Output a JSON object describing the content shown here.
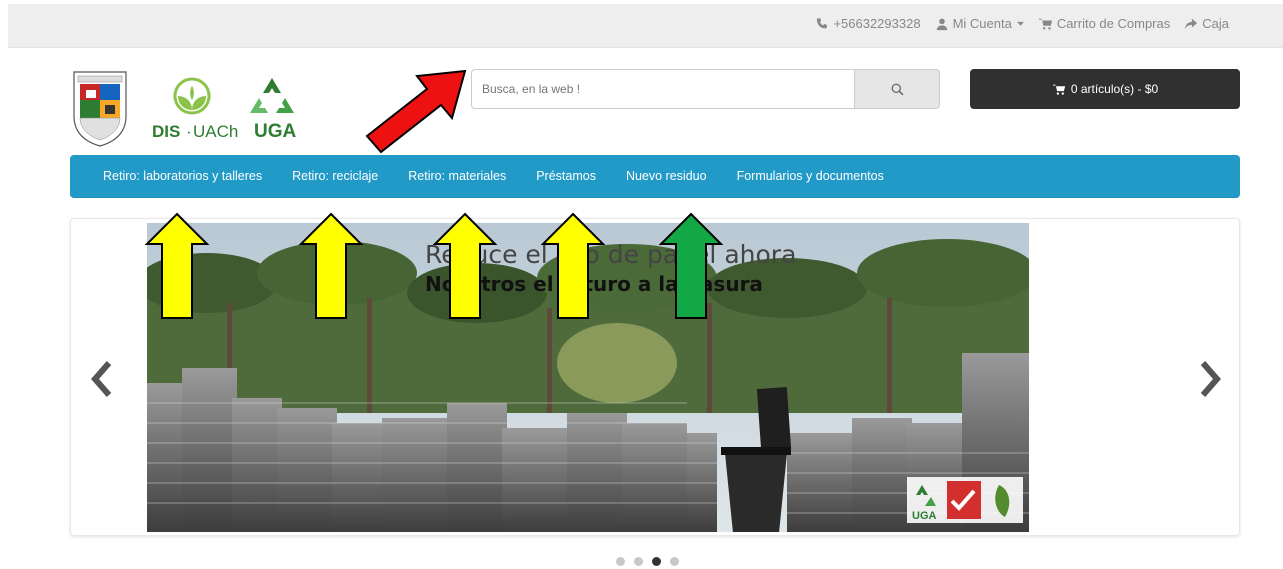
{
  "topbar": {
    "phone": "+56632293328",
    "account": "Mi Cuenta",
    "cart_link": "Carrito de Compras",
    "checkout": "Caja"
  },
  "logos": {
    "dis": "DIS",
    "uach": "UACh",
    "uga": "UGA"
  },
  "search": {
    "placeholder": "Busca, en la web !"
  },
  "cart": {
    "label": "0 artículo(s) - $0"
  },
  "nav": {
    "items": [
      {
        "label": "Retiro: laboratorios y talleres"
      },
      {
        "label": "Retiro: reciclaje"
      },
      {
        "label": "Retiro: materiales"
      },
      {
        "label": "Préstamos"
      },
      {
        "label": "Nuevo residuo"
      },
      {
        "label": "Formularios y documentos"
      }
    ]
  },
  "slide": {
    "line1": "Reduce el uso de papel ahora",
    "line2": "Nosotros el futuro a la basura",
    "badge_uga": "UGA"
  },
  "carousel": {
    "slide_count": 4,
    "active_index": 2
  },
  "colors": {
    "nav": "#229ac8",
    "cart": "#303030",
    "arrow_red": "#ee1111",
    "arrow_yellow": "#ffff00",
    "arrow_green": "#11a845"
  }
}
